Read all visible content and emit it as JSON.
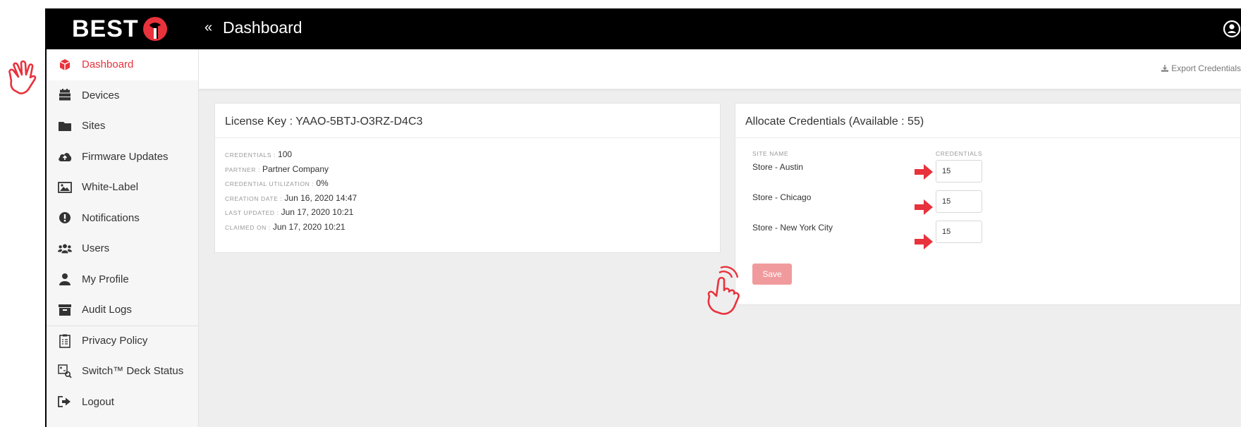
{
  "header": {
    "brand": "BEST",
    "collapse_glyph": "«",
    "title": "Dashboard",
    "icons": {
      "user": "user-circle-icon",
      "collapse": "double-chevron-left-icon"
    }
  },
  "toolbar": {
    "export_label": "Export Credentials",
    "export_icon": "download-icon"
  },
  "sidebar": {
    "items": [
      {
        "label": "Dashboard",
        "icon": "cube-icon",
        "active": true
      },
      {
        "label": "Devices",
        "icon": "stack-icon"
      },
      {
        "label": "Sites",
        "icon": "folder-icon"
      },
      {
        "label": "Firmware Updates",
        "icon": "cloud-upload-icon"
      },
      {
        "label": "White-Label",
        "icon": "image-icon"
      },
      {
        "label": "Notifications",
        "icon": "exclamation-icon"
      },
      {
        "label": "Users",
        "icon": "users-icon"
      },
      {
        "label": "My Profile",
        "icon": "user-icon"
      },
      {
        "label": "Audit Logs",
        "icon": "archive-icon"
      },
      {
        "label": "Privacy Policy",
        "icon": "clipboard-icon"
      },
      {
        "label": "Switch™ Deck Status",
        "icon": "status-search-icon"
      },
      {
        "label": "Logout",
        "icon": "logout-icon"
      }
    ]
  },
  "license": {
    "title": "License Key : YAAO-5BTJ-O3RZ-D4C3",
    "fields": [
      {
        "key": "CREDENTIALS :",
        "value": "100"
      },
      {
        "key": "PARTNER :",
        "value": "Partner Company"
      },
      {
        "key": "CREDENTIAL UTILIZATION :",
        "value": "0%"
      },
      {
        "key": "CREATION DATE :",
        "value": "Jun 16, 2020 14:47"
      },
      {
        "key": "LAST UPDATED :",
        "value": "Jun 17, 2020 10:21"
      },
      {
        "key": "CLAIMED ON :",
        "value": "Jun 17, 2020 10:21"
      }
    ]
  },
  "allocate": {
    "title": "Allocate Credentials (Available : 55)",
    "col_site": "SITE NAME",
    "col_credentials": "CREDENTIALS",
    "rows": [
      {
        "site": "Store - Austin",
        "credentials": "15"
      },
      {
        "site": "Store - Chicago",
        "credentials": "15"
      },
      {
        "site": "Store - New York City",
        "credentials": "15"
      }
    ],
    "save_label": "Save"
  },
  "colors": {
    "accent": "#e8323c",
    "topbar": "#000000",
    "save_button": "#f19a9d",
    "annotation": "#e8323c"
  }
}
